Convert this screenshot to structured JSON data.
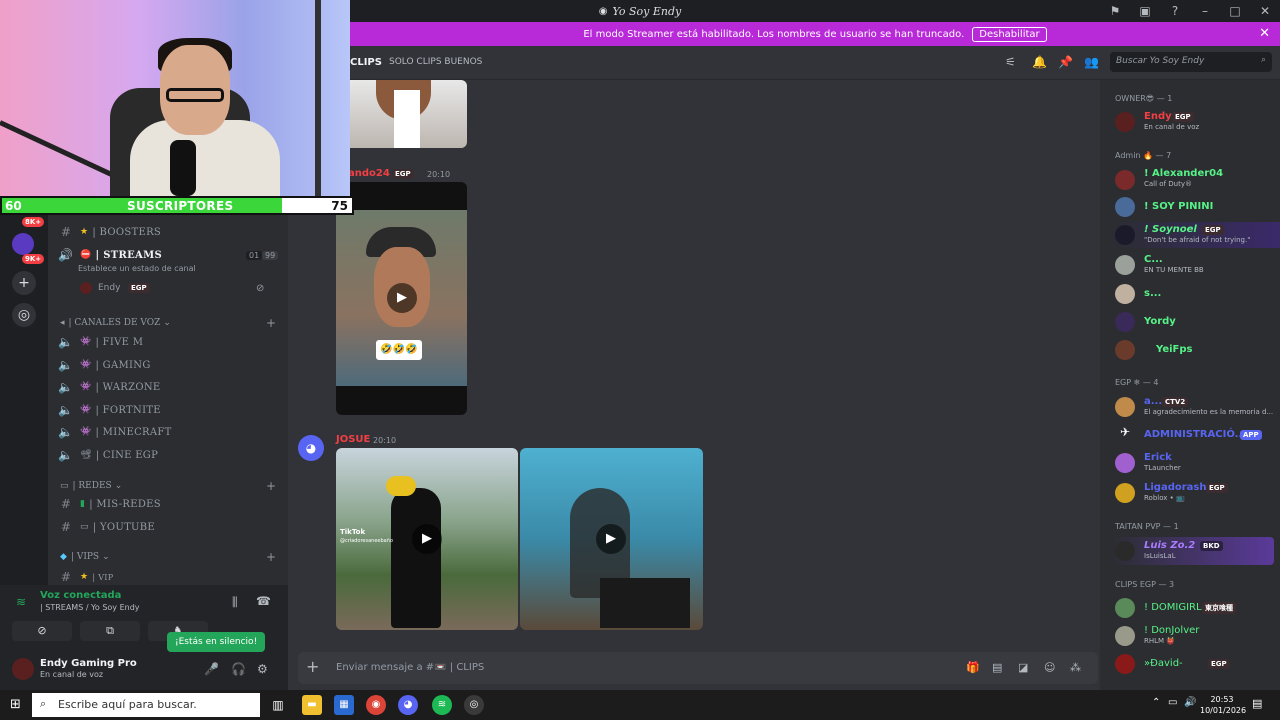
{
  "window": {
    "title": "Yo Soy Endy",
    "icons": [
      "flag-icon",
      "inbox-icon",
      "help-icon",
      "minimize-icon",
      "maximize-icon",
      "close-icon"
    ]
  },
  "streamer_banner": {
    "text": "El modo Streamer está habilitado. Los nombres de usuario se han truncado.",
    "button": "Deshabilitar",
    "close": "✕"
  },
  "subscriber_bar": {
    "left": "60",
    "label": "SUSCRIPTORES",
    "right": "75",
    "progress_percent": 80
  },
  "rail": {
    "badges": [
      "8K+",
      "9K+"
    ]
  },
  "channels": {
    "items": [
      {
        "label": "| BOOSTERS",
        "emoji": "★",
        "kind": "text"
      },
      {
        "label": "| STREAMS",
        "emoji": "⛔",
        "kind": "voice",
        "sub": "Establece un estado de canal",
        "counts": [
          "01",
          "99"
        ]
      }
    ],
    "stream_user": {
      "name": "Endy",
      "tag": "EGP"
    },
    "voice_category": "| CANALES DE VOZ",
    "voice_channels": [
      "| FIVE M",
      "| GAMING",
      "| WARZONE",
      "| FORTNITE",
      "| MINECRAFT",
      "| CINE EGP"
    ],
    "redes_category": "| REDES",
    "redes_channels": [
      "| MIS-REDES",
      "| YOUTUBE"
    ],
    "vips_category": "| VIPS",
    "vips_channels": [
      "| VIP"
    ]
  },
  "voice_panel": {
    "status": "Voz conectada",
    "channel": "| STREAMS / Yo Soy Endy",
    "tooltip": "¡Estás en silencio!",
    "user_name": "Endy Gaming Pro",
    "user_status": "En canal de voz"
  },
  "chat_header": {
    "channel": "CLIPS",
    "topic": "SOLO CLIPS BUENOS",
    "search_placeholder": "Buscar Yo Soy Endy"
  },
  "messages": [
    {
      "author": "ando24",
      "tag": "EGP",
      "time": "20:10",
      "caption": "🤣🤣🤣"
    },
    {
      "author": "JOSUE",
      "time": "20:10",
      "overlay": "TikTok",
      "overlay_handle": "@criadoresaneebaño"
    }
  ],
  "composer": {
    "placeholder": "Enviar mensaje a #📼 | CLIPS"
  },
  "members": {
    "groups": [
      {
        "title": "OWNER😎 — 1",
        "members": [
          {
            "name": "Endy",
            "tag": "EGP",
            "status": "En canal de voz",
            "color": "#f23f43"
          }
        ]
      },
      {
        "title": "Admin 🔥 — 7",
        "members": [
          {
            "name": "! Alexander04",
            "status": "Call of Duty®",
            "color": "#57f287"
          },
          {
            "name": "! SOY PININI",
            "status": "",
            "color": "#57f287"
          },
          {
            "name": "! Soynoel",
            "tag": "EGP",
            "status": "\"Don't be afraid of not trying.\"",
            "color": "#57f287"
          },
          {
            "name": "C...",
            "status": "EN TU MENTE BB",
            "color": "#57f287"
          },
          {
            "name": "s...",
            "status": "",
            "color": "#57f287"
          },
          {
            "name": "Yordy",
            "status": "",
            "color": "#57f287"
          },
          {
            "name": "YeiFps",
            "status": "",
            "color": "#57f287"
          }
        ]
      },
      {
        "title": "EGP ❄ — 4",
        "members": [
          {
            "name": "a...",
            "tag": "CTV2",
            "status": "El agradecimiento es la memoria d...",
            "color": "#5865f2"
          },
          {
            "name": "ADMINISTRACIÓ...",
            "tag": "APP",
            "status": "",
            "color": "#5865f2"
          },
          {
            "name": "Erick",
            "status": "TLauncher",
            "color": "#5865f2"
          },
          {
            "name": "Ligadorash",
            "tag": "EGP",
            "status": "Roblox • 📺",
            "color": "#5865f2"
          }
        ]
      },
      {
        "title": "TAITAN PVP — 1",
        "members": [
          {
            "name": "Luis Zo.2",
            "tag": "BKD",
            "status": "IsLuisLaL",
            "color": "#a97bff"
          }
        ]
      },
      {
        "title": "CLIPS EGP — 3",
        "members": [
          {
            "name": "! DOMIGIRL",
            "tag": "東京喰種",
            "status": "",
            "color": "#57f287"
          },
          {
            "name": "! DonJolver",
            "status": "RHLM 👹",
            "color": "#57f287"
          },
          {
            "name": "»Ðavid-",
            "tag": "EGP",
            "status": "",
            "color": "#57f287"
          }
        ]
      }
    ]
  },
  "taskbar": {
    "search_placeholder": "Escribe aquí para buscar.",
    "time": "20:53",
    "date": "10/01/2026"
  }
}
